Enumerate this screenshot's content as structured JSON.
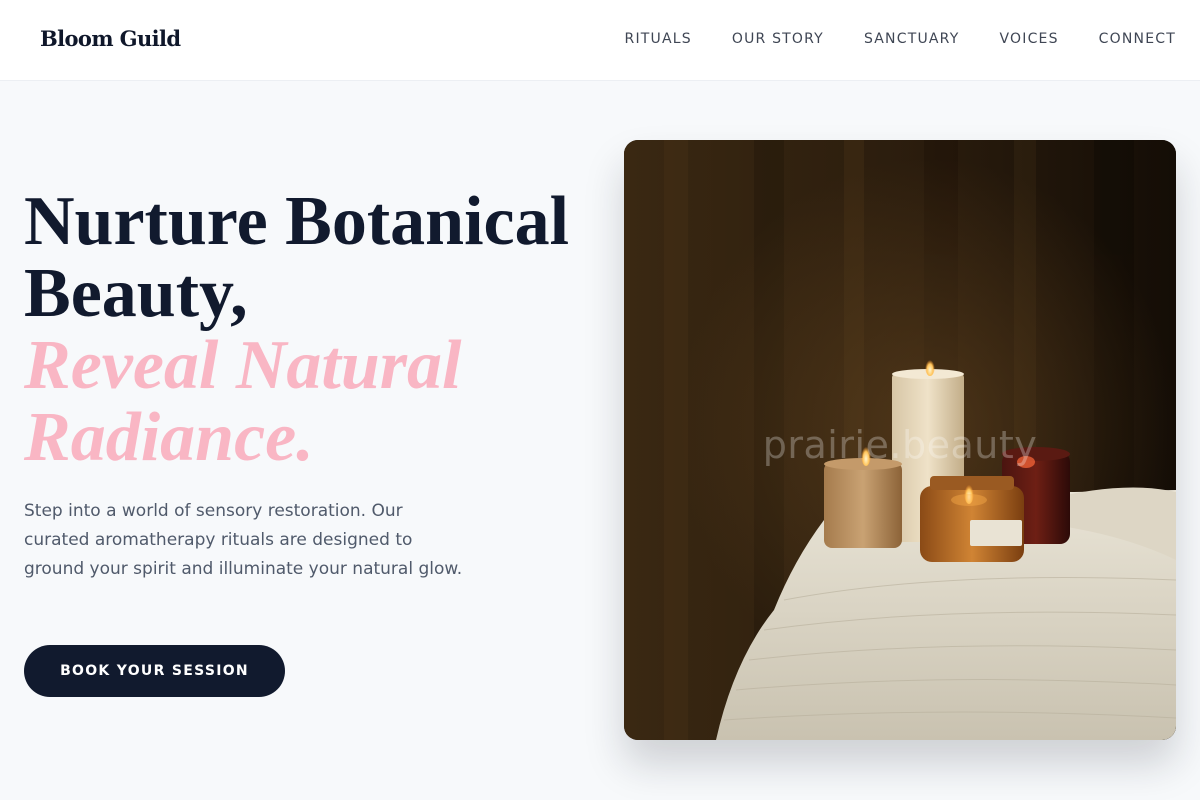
{
  "brand": {
    "name": "Bloom Guild"
  },
  "nav": {
    "items": [
      {
        "label": "RITUALS"
      },
      {
        "label": "OUR STORY"
      },
      {
        "label": "SANCTUARY"
      },
      {
        "label": "VOICES"
      },
      {
        "label": "CONNECT"
      }
    ]
  },
  "hero": {
    "headline_line1": "Nurture Botanical",
    "headline_line2": "Beauty,",
    "accent_line1": "Reveal Natural",
    "accent_line2": "Radiance.",
    "description": "Step into a world of sensory restoration. Our curated aromatherapy rituals are designed to ground your spirit and illuminate your natural glow.",
    "cta_label": "BOOK YOUR SESSION",
    "image": {
      "watermark": "prairie.beauty",
      "subject": "candles on a draped table"
    }
  },
  "colors": {
    "primary": "#111a2e",
    "accent": "#f9b6c4",
    "background": "#f7f9fb"
  }
}
